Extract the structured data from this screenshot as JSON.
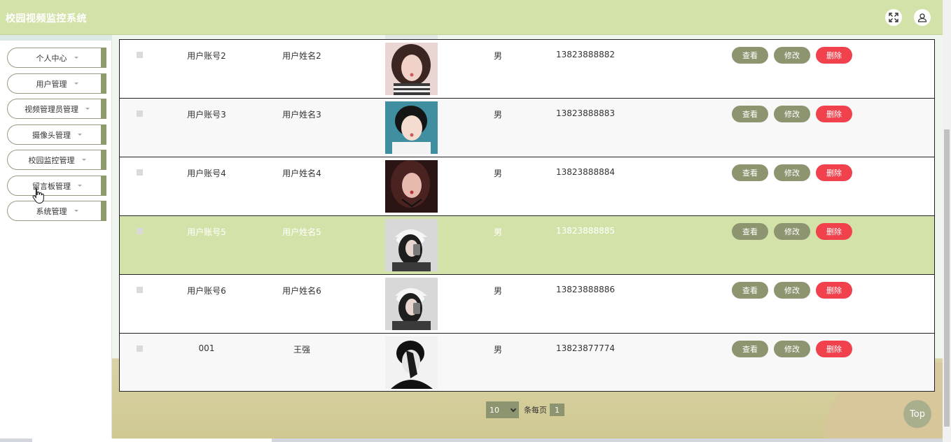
{
  "header": {
    "title": "校园视频监控系统",
    "fullscreen_icon": "fullscreen-icon",
    "user_icon": "user-icon"
  },
  "sidebar": {
    "items": [
      {
        "label": "个人中心"
      },
      {
        "label": "用户管理"
      },
      {
        "label": "视频管理员管理"
      },
      {
        "label": "摄像头管理"
      },
      {
        "label": "校园监控管理"
      },
      {
        "label": "留言板管理"
      },
      {
        "label": "系统管理"
      }
    ]
  },
  "table": {
    "rows": [
      {
        "account": "用户账号2",
        "name": "用户姓名2",
        "gender": "男",
        "phone": "13823888882",
        "avatar": "photo-girl-striped"
      },
      {
        "account": "用户账号3",
        "name": "用户姓名3",
        "gender": "男",
        "phone": "13823888883",
        "avatar": "photo-boy-white-sweater"
      },
      {
        "account": "用户账号4",
        "name": "用户姓名4",
        "gender": "男",
        "phone": "13823888884",
        "avatar": "photo-girl-dark"
      },
      {
        "account": "用户账号5",
        "name": "用户姓名5",
        "gender": "男",
        "phone": "13823888885",
        "avatar": "photo-girl-cap-selfie"
      },
      {
        "account": "用户账号6",
        "name": "用户姓名6",
        "gender": "男",
        "phone": "13823888886",
        "avatar": "photo-girl-cap-selfie"
      },
      {
        "account": "001",
        "name": "王强",
        "gender": "男",
        "phone": "13823877774",
        "avatar": "photo-man-bw"
      }
    ],
    "actions": {
      "view": "查看",
      "edit": "修改",
      "delete": "删除"
    },
    "highlighted_row": 3
  },
  "pagination": {
    "page_size": "10",
    "per_page_label": "条每页",
    "current_page": "1"
  },
  "back_to_top": {
    "label": "Top"
  },
  "colors": {
    "header": "#d3e2a9",
    "accent": "#8d9570",
    "delete": "#f0414d",
    "highlight": "#d3e2a9"
  }
}
